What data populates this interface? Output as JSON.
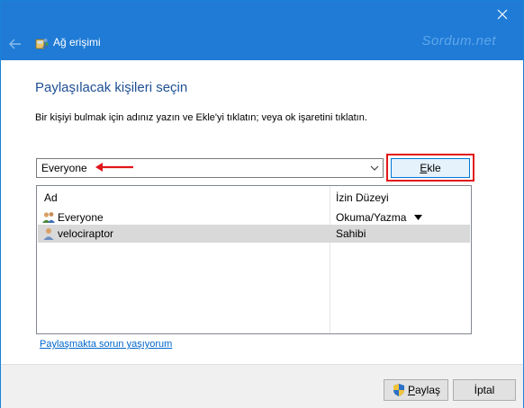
{
  "window": {
    "title": "Ağ erişimi",
    "watermark": "Sordum.net"
  },
  "icons": {
    "close": "close-icon",
    "back": "back-arrow-icon",
    "app": "network-share-icon",
    "dropdown": "chevron-down-icon",
    "annotation": "red-arrow-icon",
    "group_user": "group-users-icon",
    "single_user": "user-icon",
    "shield": "uac-shield-icon"
  },
  "colors": {
    "titlebar": "#1f7bd6",
    "heading": "#1e4f93",
    "highlight_border": "#e0161a",
    "selected_row": "#d9d9d9",
    "link": "#0066cc"
  },
  "page": {
    "heading": "Paylaşılacak kişileri seçin",
    "instruction": "Bir kişiyi bulmak için adınız yazın ve Ekle'yi tıklatın; veya ok işaretini tıklatın."
  },
  "search": {
    "value": "Everyone",
    "add_label": "Ekle",
    "add_accesskey": "E",
    "add_rest": "kle"
  },
  "table": {
    "columns": [
      "Ad",
      "İzin Düzeyi"
    ],
    "rows": [
      {
        "name": "Everyone",
        "permission": "Okuma/Yazma",
        "selected": false,
        "icon": "group-users-icon"
      },
      {
        "name": "velociraptor",
        "permission": "Sahibi",
        "selected": true,
        "icon": "user-icon"
      }
    ]
  },
  "links": {
    "trouble": "Paylaşmakta sorun yaşıyorum"
  },
  "footer": {
    "share_label": "Paylaş",
    "share_accesskey": "P",
    "share_rest": "aylaş",
    "cancel_label": "İptal"
  }
}
